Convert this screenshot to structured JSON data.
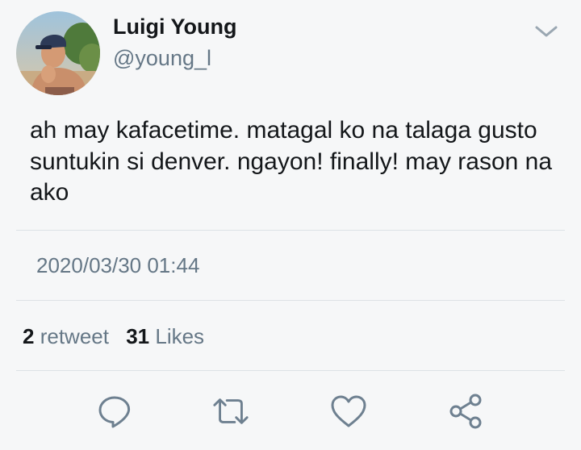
{
  "user": {
    "display_name": "Luigi Young",
    "handle": "@young_l"
  },
  "tweet": {
    "text": "ah may kafacetime. matagal ko na talaga gusto suntukin si denver. ngayon! finally! may rason na ako",
    "timestamp": "2020/03/30 01:44"
  },
  "stats": {
    "retweet_count": "2",
    "retweet_label": "retweet",
    "likes_count": "31",
    "likes_label": "Likes"
  },
  "actions": [
    {
      "icon": "reply-icon"
    },
    {
      "icon": "retweet-icon"
    },
    {
      "icon": "like-icon"
    },
    {
      "icon": "share-icon"
    }
  ],
  "colors": {
    "background": "#f6f7f8",
    "primary_text": "#14171a",
    "secondary_text": "#657786",
    "divider": "#dde2e6"
  }
}
